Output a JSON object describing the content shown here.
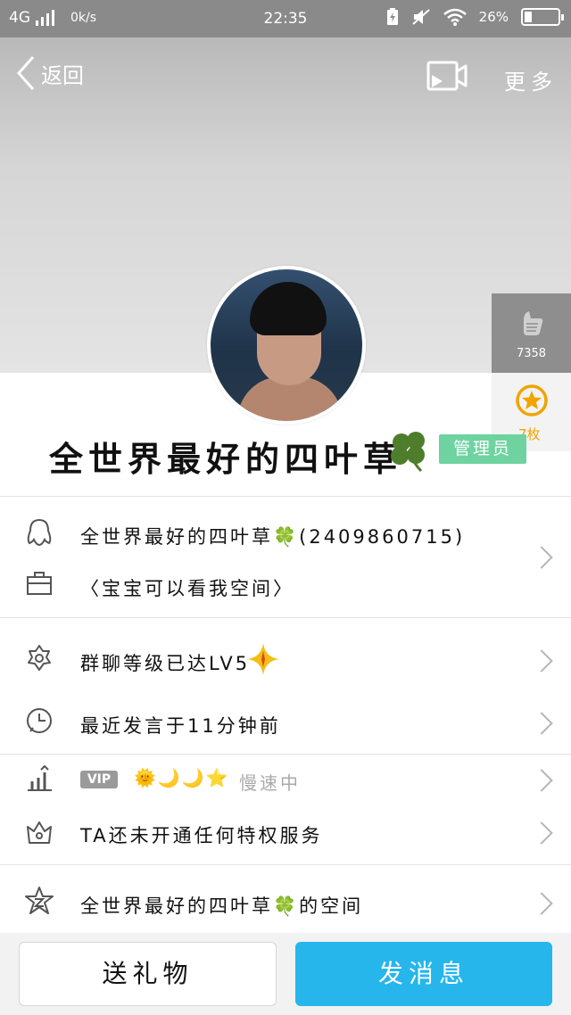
{
  "status_bar": {
    "network": "4G",
    "speed": "0k/s",
    "time": "22:35",
    "battery": "26%"
  },
  "nav": {
    "back_label": "返回",
    "more_label": "更多"
  },
  "side": {
    "like_count": "7358",
    "badge_count": "7枚"
  },
  "profile": {
    "name": "全世界最好的四叶草",
    "admin_badge": "管理员"
  },
  "info": {
    "qq_line": "全世界最好的四叶草🍀(2409860715)",
    "signature": "〈宝宝可以看我空间〉",
    "group_level": "群聊等级已达LV5",
    "last_speak": "最近发言于11分钟前",
    "vip_tag": "VIP",
    "vip_icons": "🌞🌙🌙⭐",
    "vip_status": "慢速中",
    "privilege": "TA还未开通任何特权服务",
    "space": "全世界最好的四叶草🍀的空间"
  },
  "buttons": {
    "gift": "送礼物",
    "message": "发消息"
  },
  "colors": {
    "accent": "#26b6ec",
    "admin_badge": "#6ed3a0",
    "status_bar": "#8a8a8a",
    "clover": "#4e7d2c",
    "badge_gold": "#f0a400"
  }
}
